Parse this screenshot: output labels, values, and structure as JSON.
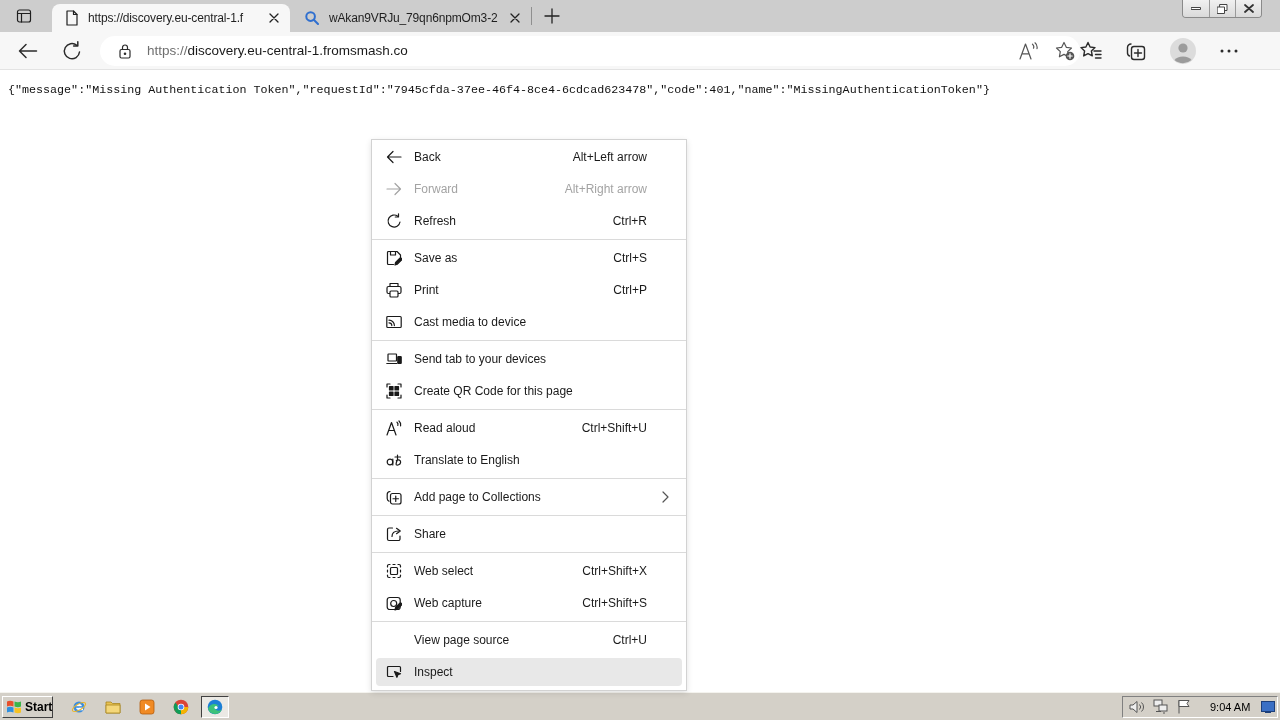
{
  "tabs": [
    {
      "title": "https://discovery.eu-central-1.f",
      "selected": true
    },
    {
      "title": "wAkan9VRJu_79qn6npmOm3-2",
      "selected": false
    }
  ],
  "address_bar": {
    "scheme": "https://",
    "host": "discovery.eu-central-1.fromsmash.co"
  },
  "page": {
    "text": "{\"message\":\"Missing Authentication Token\",\"requestId\":\"7945cfda-37ee-46f4-8ce4-6cdcad623478\",\"code\":401,\"name\":\"MissingAuthenticationToken\"}"
  },
  "context_menu": {
    "groups": [
      {
        "items": [
          {
            "label": "Back",
            "shortcut": "Alt+Left arrow",
            "disabled": false,
            "selected": false,
            "submenu": false
          },
          {
            "label": "Forward",
            "shortcut": "Alt+Right arrow",
            "disabled": true,
            "selected": false,
            "submenu": false
          },
          {
            "label": "Refresh",
            "shortcut": "Ctrl+R",
            "disabled": false,
            "selected": false,
            "submenu": false
          }
        ]
      },
      {
        "items": [
          {
            "label": "Save as",
            "shortcut": "Ctrl+S",
            "disabled": false,
            "selected": false,
            "submenu": false
          },
          {
            "label": "Print",
            "shortcut": "Ctrl+P",
            "disabled": false,
            "selected": false,
            "submenu": false
          },
          {
            "label": "Cast media to device",
            "disabled": false,
            "selected": false,
            "submenu": false
          }
        ]
      },
      {
        "items": [
          {
            "label": "Send tab to your devices",
            "disabled": false,
            "selected": false,
            "submenu": false
          },
          {
            "label": "Create QR Code for this page",
            "disabled": false,
            "selected": false,
            "submenu": false
          }
        ]
      },
      {
        "items": [
          {
            "label": "Read aloud",
            "shortcut": "Ctrl+Shift+U",
            "disabled": false,
            "selected": false,
            "submenu": false
          },
          {
            "label": "Translate to English",
            "disabled": false,
            "selected": false,
            "submenu": false
          }
        ]
      },
      {
        "items": [
          {
            "label": "Add page to Collections",
            "disabled": false,
            "selected": false,
            "submenu": true
          }
        ]
      },
      {
        "items": [
          {
            "label": "Share",
            "disabled": false,
            "selected": false,
            "submenu": false
          }
        ]
      },
      {
        "items": [
          {
            "label": "Web select",
            "shortcut": "Ctrl+Shift+X",
            "disabled": false,
            "selected": false,
            "submenu": false
          },
          {
            "label": "Web capture",
            "shortcut": "Ctrl+Shift+S",
            "disabled": false,
            "selected": false,
            "submenu": false
          }
        ]
      },
      {
        "items": [
          {
            "label": "View page source",
            "shortcut": "Ctrl+U",
            "disabled": false,
            "selected": false,
            "submenu": false
          },
          {
            "label": "Inspect",
            "disabled": false,
            "selected": true,
            "submenu": false
          }
        ]
      }
    ]
  },
  "taskbar": {
    "start_label": "Start",
    "apps": [
      {
        "selected": false
      },
      {
        "selected": false
      },
      {
        "selected": false
      },
      {
        "selected": false
      },
      {
        "selected": true
      }
    ],
    "clock": "9:04 AM"
  }
}
